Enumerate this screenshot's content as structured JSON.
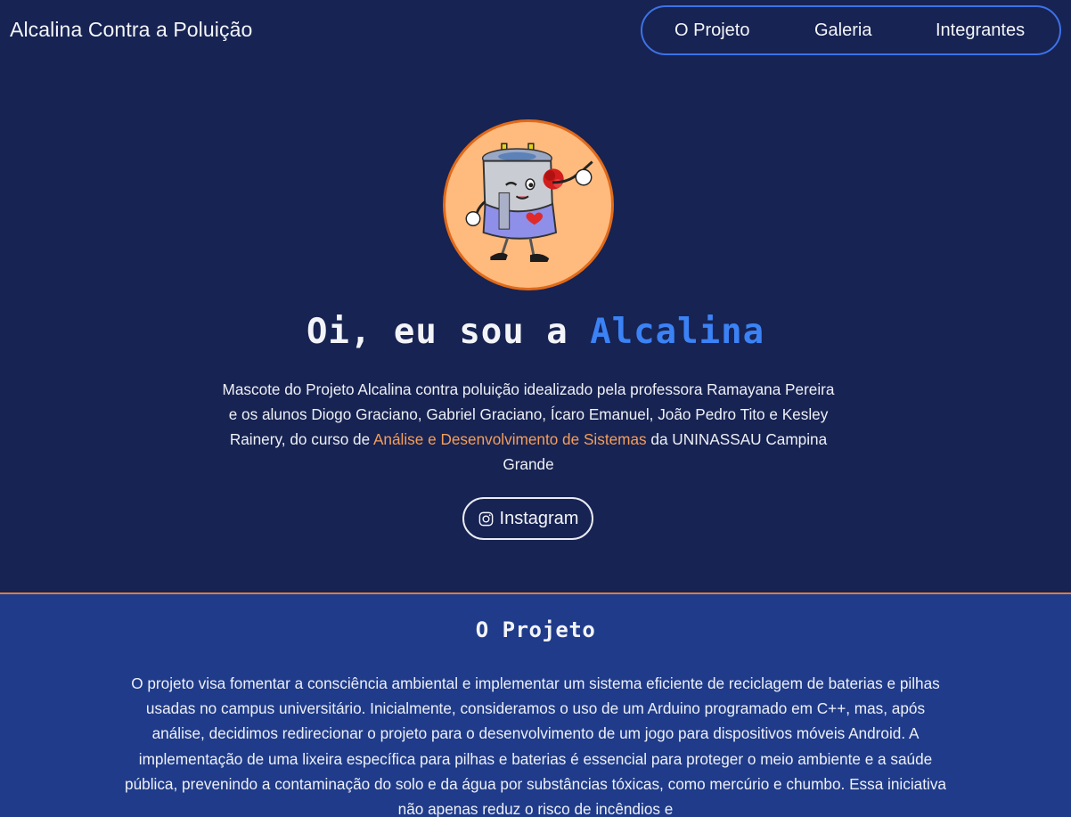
{
  "header": {
    "brand": "Alcalina Contra a Poluição",
    "nav": [
      "O Projeto",
      "Galeria",
      "Integrantes"
    ]
  },
  "hero": {
    "title_prefix": "Oi, eu sou a ",
    "title_accent": "Alcalina",
    "desc_part1": "Mascote do Projeto Alcalina contra poluição idealizado pela professora Ramayana Pereira e os alunos Diogo Graciano, Gabriel Graciano, Ícaro Emanuel, João Pedro Tito e Kesley Rainery, do curso de ",
    "desc_course": "Análise e Desenvolvimento de Sistemas",
    "desc_part2": " da UNINASSAU Campina Grande",
    "instagram_label": "Instagram",
    "mascot_icon": "battery-mascot",
    "instagram_icon": "instagram-icon"
  },
  "project": {
    "title": "O Projeto",
    "text": "O projeto visa fomentar a consciência ambiental e implementar um sistema eficiente de reciclagem de baterias e pilhas usadas no campus universitário. Inicialmente, consideramos o uso de um Arduino programado em C++, mas, após análise, decidimos redirecionar o projeto para o desenvolvimento de um jogo para dispositivos móveis Android. A implementação de uma lixeira específica para pilhas e baterias é essencial para proteger o meio ambiente e a saúde pública, prevenindo a contaminação do solo e da água por substâncias tóxicas, como mercúrio e chumbo. Essa iniciativa não apenas reduz o risco de incêndios e"
  },
  "colors": {
    "background": "#172352",
    "section_background": "#1f3b8a",
    "accent_blue": "#3b82f6",
    "accent_orange": "#f59e5b",
    "avatar_bg": "#ffba7d",
    "avatar_border": "#e06a1a"
  }
}
